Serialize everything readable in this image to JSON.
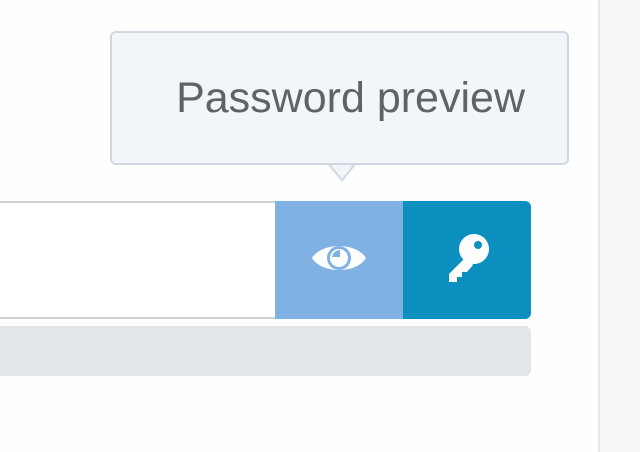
{
  "tooltip": {
    "text": "Password preview"
  },
  "password_field": {
    "value": "",
    "placeholder": ""
  },
  "buttons": {
    "preview_icon": "eye-icon",
    "generate_icon": "key-icon"
  },
  "strength": {
    "fraction": 0
  },
  "colors": {
    "preview_button": "#7fb2e2",
    "generate_button": "#0a8fbf",
    "tooltip_bg": "#f2f6fa",
    "tooltip_text": "#5f6367",
    "strength_track": "#e3e6e9"
  }
}
